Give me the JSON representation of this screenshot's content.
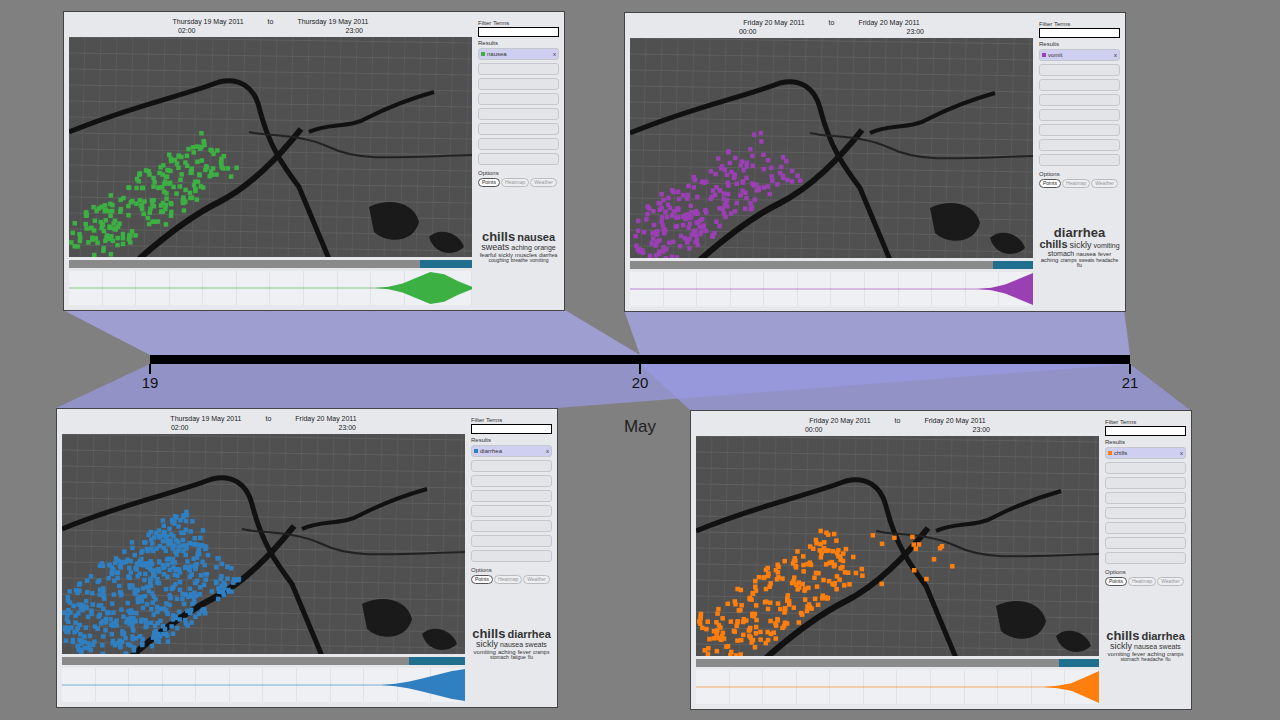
{
  "timeline": {
    "ticks": [
      "19",
      "20",
      "21"
    ],
    "month": "May"
  },
  "panels": [
    {
      "start_date": "Thursday 19 May 2011",
      "to": "to",
      "end_date": "Thursday 19 May 2011",
      "start_time": "02:00",
      "end_time": "23:00",
      "color": "#3cb043",
      "filter_label": "Filter Terms",
      "filter_value": "",
      "results_label": "Results",
      "results": [
        {
          "term": "nausea",
          "remove": "x"
        },
        {
          "term": "",
          "remove": ""
        },
        {
          "term": "",
          "remove": ""
        },
        {
          "term": "",
          "remove": ""
        },
        {
          "term": "",
          "remove": ""
        },
        {
          "term": "",
          "remove": ""
        },
        {
          "term": "",
          "remove": ""
        },
        {
          "term": "",
          "remove": ""
        }
      ],
      "options_label": "Options",
      "options": [
        {
          "label": "Points",
          "selected": true
        },
        {
          "label": "Heatmap",
          "selected": false
        },
        {
          "label": "Weather",
          "selected": false
        }
      ],
      "words": [
        "chills",
        "nausea",
        "sweats",
        "aching",
        "orange",
        "fearful",
        "sickly",
        "muscles",
        "diarrhea",
        "coughing",
        "breathe",
        "vomiting"
      ],
      "range_level": 0.13,
      "histogram": [
        0,
        0,
        0,
        0,
        0,
        0,
        0,
        0,
        0,
        0,
        0,
        0,
        0,
        0,
        0,
        0,
        0,
        0,
        0,
        0,
        0,
        0,
        0,
        1,
        4,
        9,
        14,
        12,
        6,
        1
      ]
    },
    {
      "start_date": "Friday 20 May 2011",
      "to": "to",
      "end_date": "Friday 20 May 2011",
      "start_time": "00:00",
      "end_time": "23:00",
      "color": "#9b3fb5",
      "filter_label": "Filter Terms",
      "filter_value": "",
      "results_label": "Results",
      "results": [
        {
          "term": "vomit",
          "remove": "x"
        },
        {
          "term": "",
          "remove": ""
        },
        {
          "term": "",
          "remove": ""
        },
        {
          "term": "",
          "remove": ""
        },
        {
          "term": "",
          "remove": ""
        },
        {
          "term": "",
          "remove": ""
        },
        {
          "term": "",
          "remove": ""
        },
        {
          "term": "",
          "remove": ""
        }
      ],
      "options_label": "Options",
      "options": [
        {
          "label": "Points",
          "selected": true
        },
        {
          "label": "Heatmap",
          "selected": false
        },
        {
          "label": "Weather",
          "selected": false
        }
      ],
      "words": [
        "diarrhea",
        "chills",
        "sickly",
        "vomiting",
        "stomach",
        "nausea",
        "fever",
        "aching",
        "cramps",
        "sweats",
        "headache",
        "flu"
      ],
      "range_level": 0.1,
      "histogram": [
        0,
        0,
        0,
        0,
        0,
        0,
        0,
        0,
        0,
        0,
        0,
        0,
        0,
        0,
        0,
        0,
        0,
        0,
        0,
        0,
        0,
        0,
        0,
        0,
        0,
        0,
        1,
        4,
        9,
        14
      ]
    },
    {
      "start_date": "Thursday 19 May 2011",
      "to": "to",
      "end_date": "Friday 20 May 2011",
      "start_time": "02:00",
      "end_time": "23:00",
      "color": "#2f7fc1",
      "filter_label": "Filter Terms",
      "filter_value": "",
      "results_label": "Results",
      "results": [
        {
          "term": "diarrhea",
          "remove": "x"
        },
        {
          "term": "",
          "remove": ""
        },
        {
          "term": "",
          "remove": ""
        },
        {
          "term": "",
          "remove": ""
        },
        {
          "term": "",
          "remove": ""
        },
        {
          "term": "",
          "remove": ""
        },
        {
          "term": "",
          "remove": ""
        },
        {
          "term": "",
          "remove": ""
        }
      ],
      "options_label": "Options",
      "options": [
        {
          "label": "Points",
          "selected": true
        },
        {
          "label": "Heatmap",
          "selected": false
        },
        {
          "label": "Weather",
          "selected": false
        }
      ],
      "words": [
        "chills",
        "diarrhea",
        "sickly",
        "nausea",
        "sweats",
        "vomiting",
        "aching",
        "fever",
        "cramps",
        "stomach",
        "fatigue",
        "flu"
      ],
      "range_level": 0.14,
      "histogram": [
        0,
        0,
        0,
        0,
        0,
        0,
        0,
        0,
        0,
        0,
        0,
        0,
        0,
        0,
        0,
        0,
        0,
        0,
        0,
        0,
        0,
        0,
        0,
        0,
        1,
        3,
        6,
        9,
        12,
        14
      ]
    },
    {
      "start_date": "Friday 20 May 2011",
      "to": "to",
      "end_date": "Friday 20 May 2011",
      "start_time": "00:00",
      "end_time": "23:00",
      "color": "#ff7f0e",
      "filter_label": "Filter Terms",
      "filter_value": "",
      "results_label": "Results",
      "results": [
        {
          "term": "chills",
          "remove": "x"
        },
        {
          "term": "",
          "remove": ""
        },
        {
          "term": "",
          "remove": ""
        },
        {
          "term": "",
          "remove": ""
        },
        {
          "term": "",
          "remove": ""
        },
        {
          "term": "",
          "remove": ""
        },
        {
          "term": "",
          "remove": ""
        },
        {
          "term": "",
          "remove": ""
        }
      ],
      "options_label": "Options",
      "options": [
        {
          "label": "Points",
          "selected": true
        },
        {
          "label": "Heatmap",
          "selected": false
        },
        {
          "label": "Weather",
          "selected": false
        }
      ],
      "words": [
        "chills",
        "diarrhea",
        "sickly",
        "nausea",
        "sweats",
        "vomiting",
        "fever",
        "aching",
        "cramps",
        "stomach",
        "headache",
        "flu"
      ],
      "range_level": 0.1,
      "histogram": [
        0,
        0,
        0,
        0,
        0,
        0,
        0,
        0,
        0,
        0,
        0,
        0,
        0,
        0,
        0,
        0,
        0,
        0,
        0,
        0,
        0,
        0,
        0,
        0,
        0,
        0,
        1,
        3,
        8,
        13
      ]
    }
  ]
}
